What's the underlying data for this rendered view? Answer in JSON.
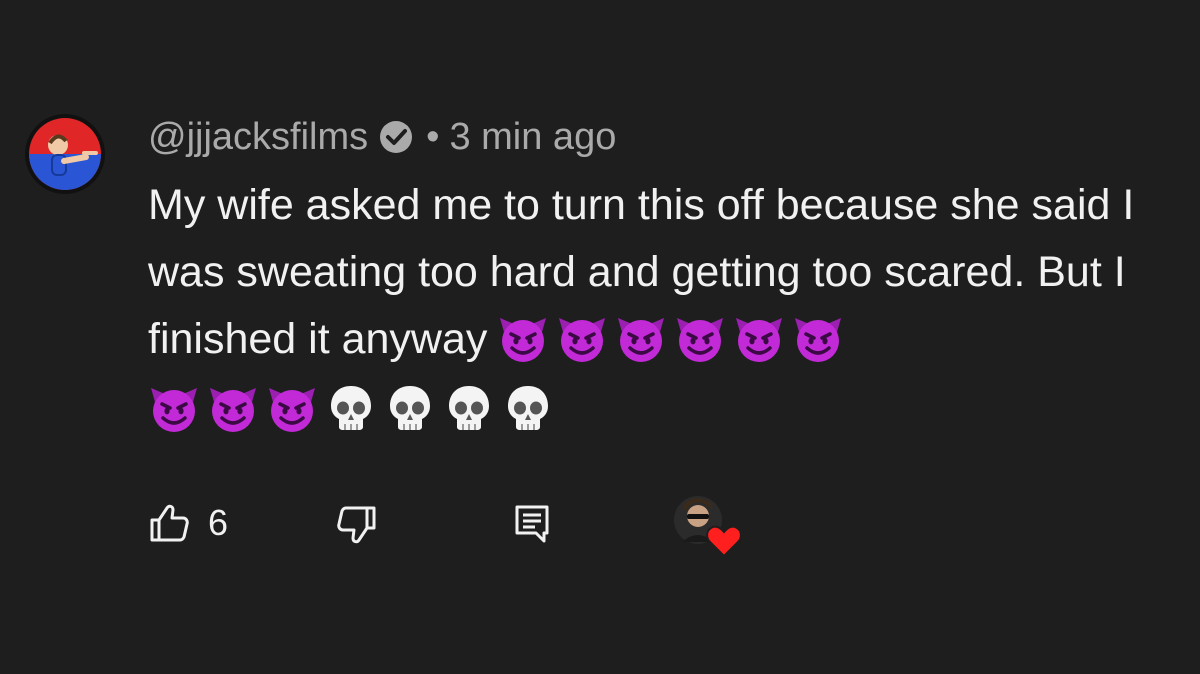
{
  "comment": {
    "handle": "@jjjacksfilms",
    "verified": true,
    "separator": "•",
    "timestamp": "3 min ago",
    "text": "My wife asked me to turn this off because she said I was sweating too hard and getting too scared. But I finished it anyway",
    "emojis_inline": [
      "smiling-imp",
      "smiling-imp",
      "smiling-imp",
      "smiling-imp",
      "smiling-imp",
      "smiling-imp"
    ],
    "emojis_next_line": [
      "smiling-imp",
      "smiling-imp",
      "smiling-imp",
      "skull",
      "skull",
      "skull",
      "skull"
    ]
  },
  "actions": {
    "like_count": "6",
    "like_icon": "thumbs-up-icon",
    "dislike_icon": "thumbs-down-icon",
    "reply_icon": "comment-icon",
    "creator_heart": "creator-heart-badge"
  },
  "colors": {
    "background": "#1e1e1e",
    "text": "#f1f1f1",
    "secondary_text": "#aaaaaa",
    "emoji_purple": "#c12ad6",
    "heart_red": "#ff1f1f"
  }
}
